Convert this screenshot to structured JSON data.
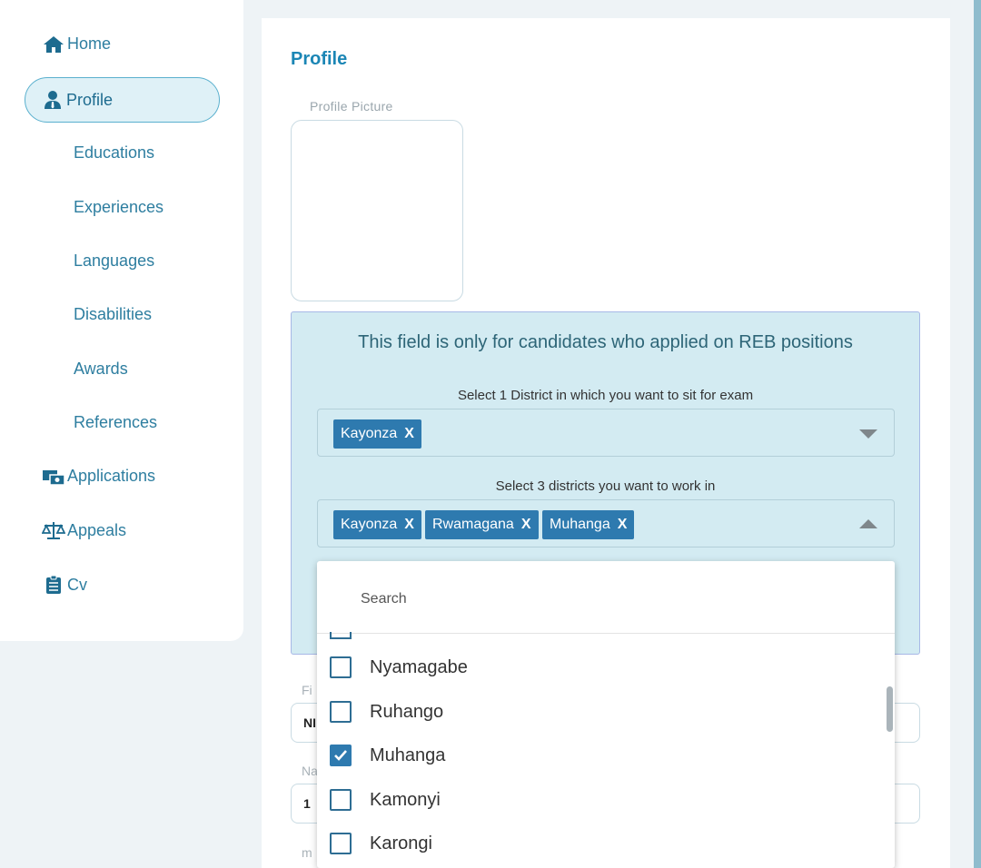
{
  "sidebar": {
    "home": "Home",
    "profile": "Profile",
    "subs": [
      "Educations",
      "Experiences",
      "Languages",
      "Disabilities",
      "Awards",
      "References"
    ],
    "applications": "Applications",
    "appeals": "Appeals",
    "cv": "Cv"
  },
  "main": {
    "title": "Profile",
    "picture_label": "Profile Picture",
    "reb_notice": "This field is only for candidates who applied on REB positions",
    "exam_district_label": "Select 1 District in which you want to sit for exam",
    "exam_district_chips": [
      "Kayonza"
    ],
    "work_districts_label": "Select 3 districts you want to work in",
    "work_districts_chips": [
      "Kayonza",
      "Rwamagana",
      "Muhanga"
    ],
    "chip_remove": "X",
    "bg_labels": [
      "Fi",
      "Na",
      "m"
    ],
    "bg_values": [
      "NI",
      "1"
    ]
  },
  "dropdown": {
    "search_placeholder": "Search",
    "options": [
      {
        "label": "Nyamagabe",
        "checked": false
      },
      {
        "label": "Ruhango",
        "checked": false
      },
      {
        "label": "Muhanga",
        "checked": true
      },
      {
        "label": "Kamonyi",
        "checked": false
      },
      {
        "label": "Karongi",
        "checked": false
      }
    ]
  },
  "colors": {
    "accent": "#1b86b5",
    "chip": "#2e7aaf",
    "notice_bg": "#d3ebf2"
  },
  "icons": {
    "home": "home-icon",
    "profile": "user-tie-icon",
    "applications": "applications-icon",
    "appeals": "balance-scale-icon",
    "cv": "clipboard-list-icon"
  }
}
